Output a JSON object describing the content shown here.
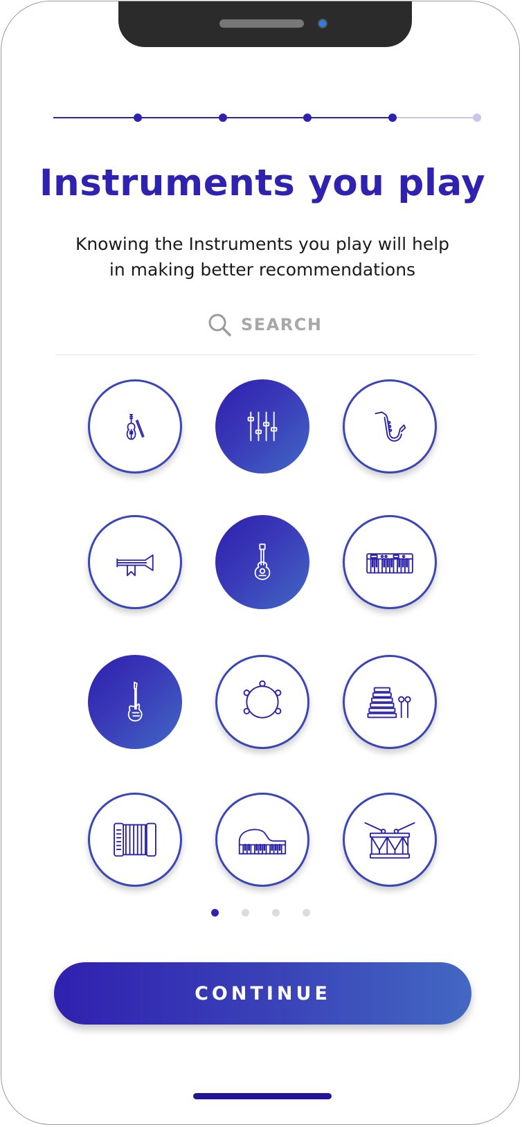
{
  "header": {
    "title": "Instruments you play",
    "subtitle": "Knowing the Instruments you play will help in making better recommendations"
  },
  "progress": {
    "total_steps": 6,
    "completed_steps": 5
  },
  "search": {
    "placeholder": "SEARCH",
    "icon": "search-icon"
  },
  "instruments": [
    {
      "icon": "violin-icon",
      "selected": false
    },
    {
      "icon": "mixer-icon",
      "selected": true
    },
    {
      "icon": "saxophone-icon",
      "selected": false
    },
    {
      "icon": "trumpet-icon",
      "selected": false
    },
    {
      "icon": "acoustic-guitar-icon",
      "selected": true
    },
    {
      "icon": "synthesizer-icon",
      "selected": false
    },
    {
      "icon": "electric-guitar-icon",
      "selected": true
    },
    {
      "icon": "tambourine-icon",
      "selected": false
    },
    {
      "icon": "xylophone-icon",
      "selected": false
    },
    {
      "icon": "accordion-icon",
      "selected": false
    },
    {
      "icon": "piano-icon",
      "selected": false
    },
    {
      "icon": "drum-icon",
      "selected": false
    }
  ],
  "pager": {
    "pages": 4,
    "current": 1
  },
  "continue_label": "CONTINUE",
  "colors": {
    "accent": "#3022b0",
    "accent_light": "#4168c4",
    "progress_inactive": "#c9c6ea",
    "pager_inactive": "#dcdcdc"
  }
}
